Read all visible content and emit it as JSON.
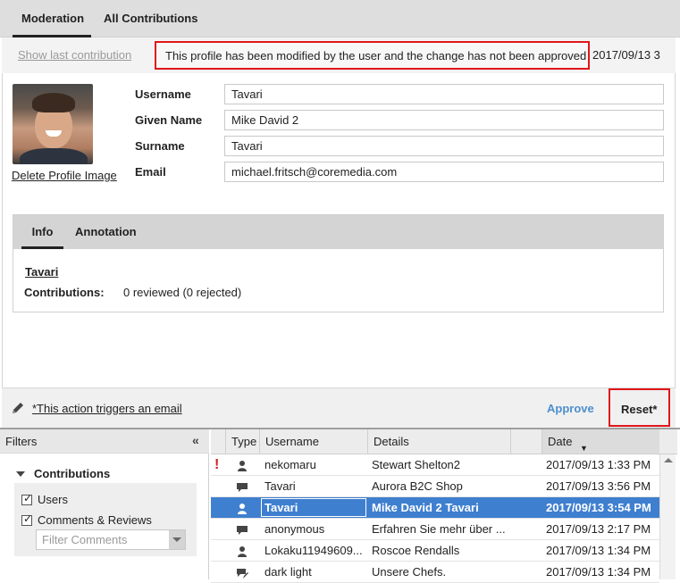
{
  "tabs": {
    "moderation": "Moderation",
    "all_contributions": "All Contributions"
  },
  "notice": {
    "show_last": "Show last contribution",
    "message": "This profile has been modified by the user and the change has not been approved",
    "date": "2017/09/13 3"
  },
  "profile": {
    "delete_image": "Delete Profile Image",
    "fields": [
      {
        "label": "Username",
        "value": "Tavari"
      },
      {
        "label": "Given Name",
        "value": "Mike David 2"
      },
      {
        "label": "Surname",
        "value": "Tavari"
      },
      {
        "label": "Email",
        "value": "michael.fritsch@coremedia.com"
      }
    ]
  },
  "info": {
    "tab_info": "Info",
    "tab_annotation": "Annotation",
    "user_link": "Tavari",
    "contributions_label": "Contributions:",
    "contributions_value": "0 reviewed (0 rejected)"
  },
  "actions": {
    "email_note": "*This action triggers an email",
    "approve": "Approve",
    "reset": "Reset*"
  },
  "filters": {
    "title": "Filters",
    "collapse_glyph": "«",
    "group": "Contributions",
    "users": "Users",
    "comments": "Comments & Reviews",
    "filter_placeholder": "Filter Comments"
  },
  "grid": {
    "headers": {
      "type": "Type",
      "username": "Username",
      "details": "Details",
      "date": "Date"
    },
    "rows": [
      {
        "flag": "!",
        "icon": "user-icon",
        "username": "nekomaru",
        "details": "Stewart Shelton2",
        "date": "2017/09/13 1:33 PM"
      },
      {
        "flag": "",
        "icon": "comment-icon",
        "username": "Tavari",
        "details": "Aurora B2C Shop",
        "date": "2017/09/13 3:56 PM"
      },
      {
        "flag": "",
        "icon": "user-icon",
        "username": "Tavari",
        "details": "Mike David 2 Tavari",
        "date": "2017/09/13 3:54 PM",
        "selected": true
      },
      {
        "flag": "",
        "icon": "comment-icon",
        "username": "anonymous",
        "details": "Erfahren Sie mehr über ...",
        "date": "2017/09/13 2:17 PM"
      },
      {
        "flag": "",
        "icon": "user-icon",
        "username": "Lokaku11949609...",
        "details": "Roscoe Rendalls",
        "date": "2017/09/13 1:34 PM"
      },
      {
        "flag": "",
        "icon": "comment-edit-icon",
        "username": "dark light",
        "details": "Unsere Chefs.",
        "date": "2017/09/13 1:34 PM"
      }
    ]
  },
  "colors": {
    "accent": "#3f7fcf",
    "highlight_border": "#e0161a",
    "approve": "#4d8fcc",
    "flag": "#cc1f1f"
  }
}
